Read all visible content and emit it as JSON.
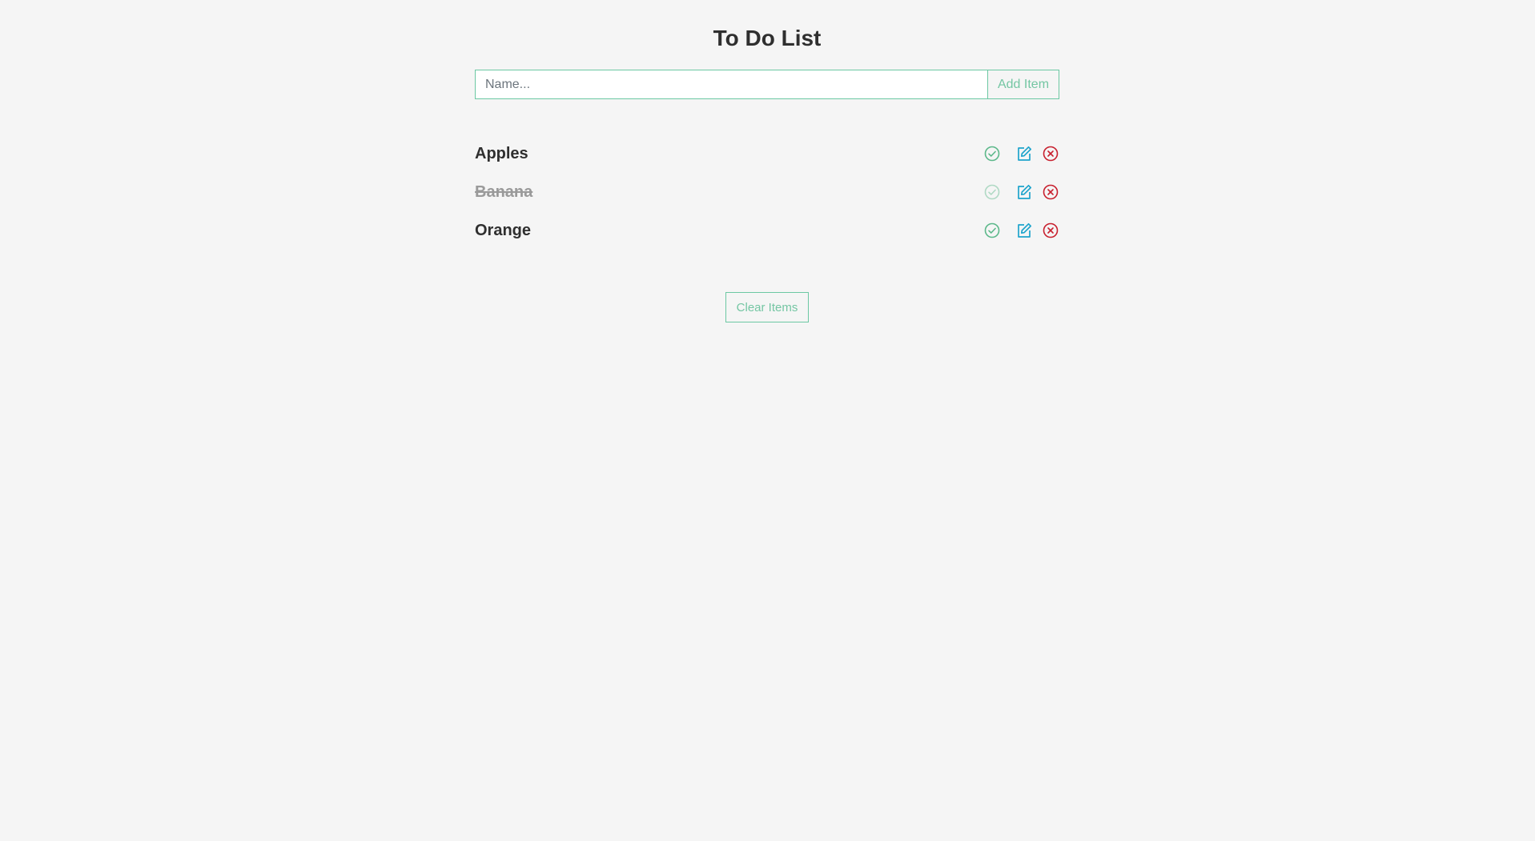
{
  "app": {
    "title": "To Do List"
  },
  "form": {
    "input_value": "",
    "input_placeholder": "Name...",
    "add_button_label": "Add Item"
  },
  "items": [
    {
      "label": "Apples",
      "completed": false
    },
    {
      "label": "Banana",
      "completed": true
    },
    {
      "label": "Orange",
      "completed": false
    }
  ],
  "icons": {
    "complete": "check-circle-icon",
    "edit": "edit-icon",
    "delete": "x-circle-icon"
  },
  "colors": {
    "accent_green": "#5cb88a",
    "edit_blue": "#1ea4cc",
    "delete_red": "#c8202e",
    "background": "#f5f5f5"
  },
  "footer": {
    "clear_button_label": "Clear Items"
  }
}
